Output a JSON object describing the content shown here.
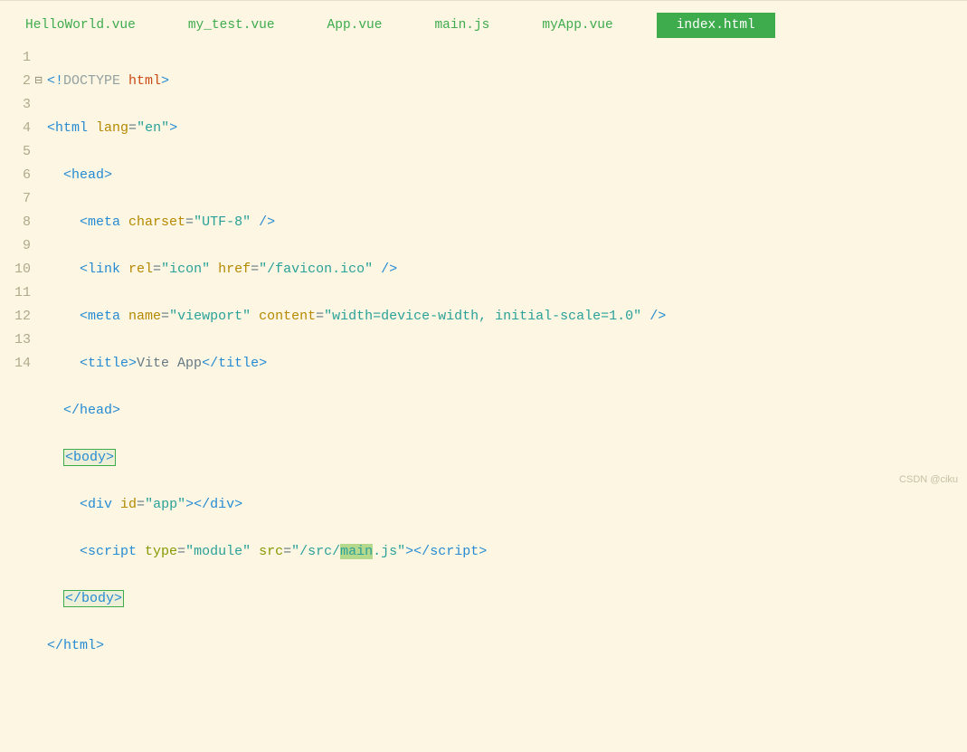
{
  "tabs": [
    {
      "label": "HelloWorld.vue",
      "active": false
    },
    {
      "label": "my_test.vue",
      "active": false
    },
    {
      "label": "App.vue",
      "active": false
    },
    {
      "label": "main.js",
      "active": false
    },
    {
      "label": "myApp.vue",
      "active": false
    },
    {
      "label": "index.html",
      "active": true
    }
  ],
  "gutter": [
    "1",
    "2",
    "3",
    "4",
    "5",
    "6",
    "7",
    "8",
    "9",
    "10",
    "11",
    "12",
    "13",
    "14"
  ],
  "fold": [
    "",
    "⊟",
    "",
    "",
    "",
    "",
    "",
    "",
    "",
    "",
    "",
    "",
    "",
    ""
  ],
  "code": {
    "l1": {
      "a": "<!",
      "b": "DOCTYPE ",
      "c": "html",
      "d": ">"
    },
    "l2": {
      "a": "<",
      "b": "html ",
      "c": "lang",
      "d": "=",
      "e": "\"en\"",
      "f": ">"
    },
    "l3": {
      "a": "  <",
      "b": "head",
      "c": ">"
    },
    "l4": {
      "a": "    <",
      "b": "meta ",
      "c": "charset",
      "d": "=",
      "e": "\"UTF-8\"",
      "f": " />"
    },
    "l5": {
      "a": "    <",
      "b": "link ",
      "c": "rel",
      "d": "=",
      "e": "\"icon\"",
      "f": " ",
      "g": "href",
      "h": "=",
      "i": "\"/favicon.ico\"",
      "j": " />"
    },
    "l6": {
      "a": "    <",
      "b": "meta ",
      "c": "name",
      "d": "=",
      "e": "\"viewport\"",
      "f": " ",
      "g": "content",
      "h": "=",
      "i": "\"width=device-width, initial-scale=1.0\"",
      "j": " />"
    },
    "l7": {
      "a": "    <",
      "b": "title",
      "c": ">",
      "d": "Vite App",
      "e": "</",
      "f": "title",
      "g": ">"
    },
    "l8": {
      "a": "  </",
      "b": "head",
      "c": ">"
    },
    "l9": {
      "a": "  ",
      "b": "<",
      "c": "body",
      "d": ">"
    },
    "l10": {
      "a": "    <",
      "b": "div ",
      "c": "id",
      "d": "=",
      "e": "\"app\"",
      "f": "></",
      "g": "div",
      "h": ">"
    },
    "l11": {
      "a": "    <",
      "b": "script ",
      "c": "type",
      "d": "=",
      "e": "\"module\"",
      "f": " ",
      "g": "src",
      "h": "=",
      "i": "\"/src/",
      "j": "main",
      "k": ".js\"",
      "l": "></",
      "m": "script",
      "n": ">"
    },
    "l12": {
      "a": "  ",
      "b": "</",
      "c": "body",
      "d": ">"
    },
    "l13": {
      "a": "</",
      "b": "html",
      "c": ">"
    },
    "l14": ""
  },
  "watermark": "CSDN @ciku"
}
